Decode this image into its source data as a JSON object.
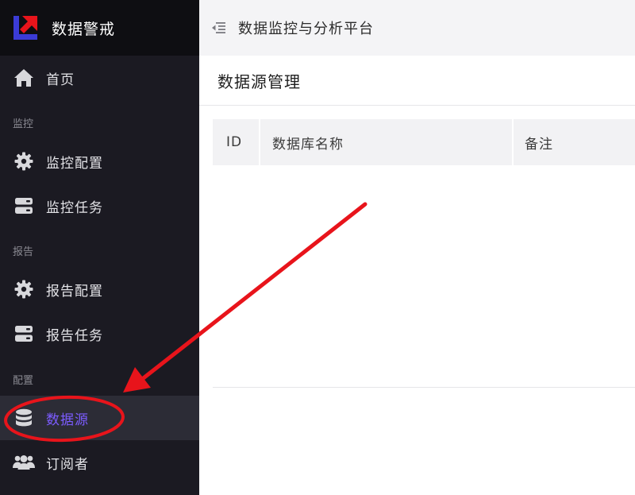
{
  "brand": {
    "name": "数据警戒",
    "logo_icon": "brand-logo-icon"
  },
  "topbar": {
    "title": "数据监控与分析平台",
    "fold_icon": "menu-fold-icon"
  },
  "sidebar": {
    "home": {
      "label": "首页",
      "icon": "home-icon"
    },
    "groups": {
      "monitor": "监控",
      "report": "报告",
      "config": "配置"
    },
    "items": {
      "monitor_config": {
        "label": "监控配置",
        "icon": "gear-icon"
      },
      "monitor_task": {
        "label": "监控任务",
        "icon": "server-icon"
      },
      "report_config": {
        "label": "报告配置",
        "icon": "gear-icon"
      },
      "report_task": {
        "label": "报告任务",
        "icon": "server-icon"
      },
      "datasource": {
        "label": "数据源",
        "icon": "database-icon",
        "active": true
      },
      "subscriber": {
        "label": "订阅者",
        "icon": "users-icon"
      }
    }
  },
  "page": {
    "title": "数据源管理"
  },
  "table": {
    "columns": [
      "ID",
      "数据库名称",
      "备注"
    ],
    "rows": []
  },
  "colors": {
    "sidebar_bg": "#1b1a22",
    "brand_bg": "#0e0e12",
    "active_text": "#7c5cff",
    "annotation": "#e8141b"
  }
}
